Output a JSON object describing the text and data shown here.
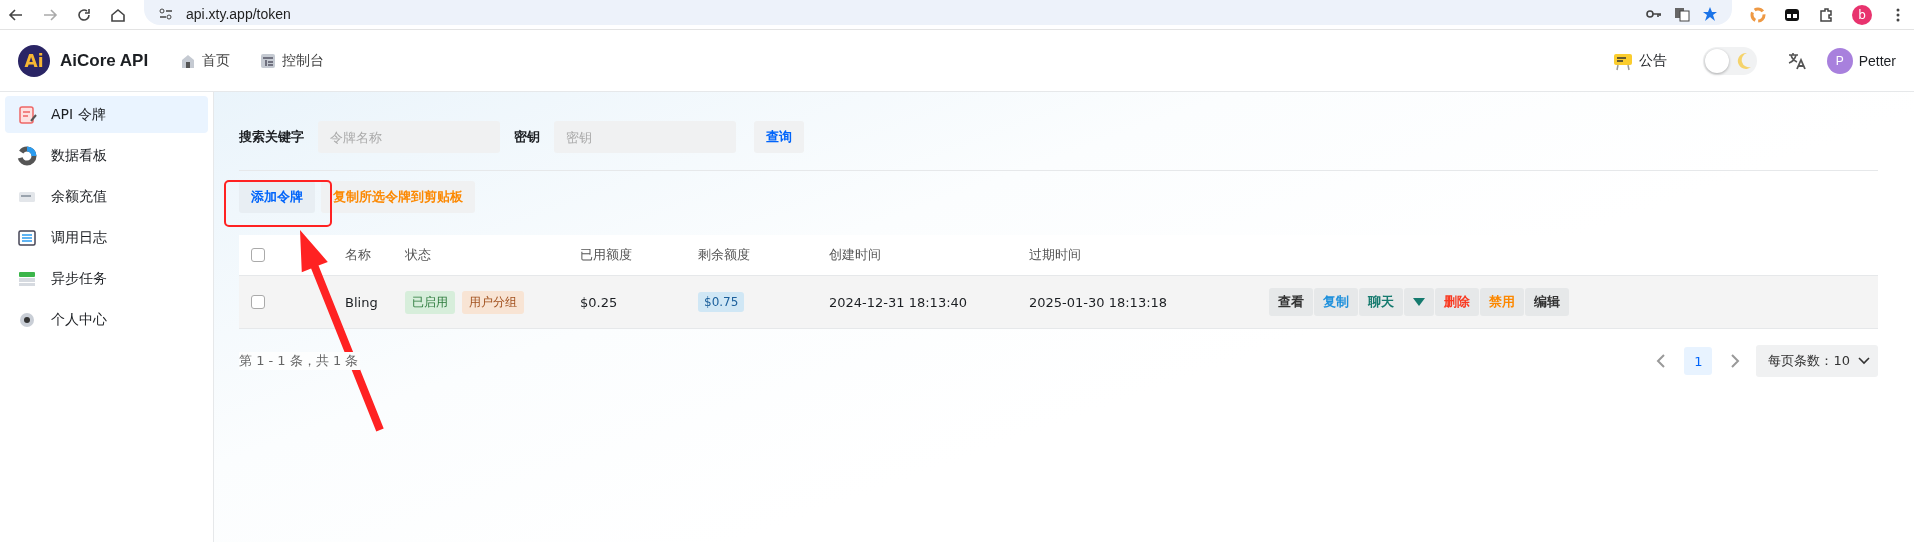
{
  "browser": {
    "url": "api.xty.app/token",
    "profile": "b"
  },
  "header": {
    "logo_text": "Ai",
    "brand": "AiCore API",
    "nav": [
      {
        "label": "首页"
      },
      {
        "label": "控制台"
      }
    ],
    "notice": "公告",
    "theme_toggle": {
      "on": false
    },
    "user": {
      "initial": "P",
      "name": "Petter"
    }
  },
  "sidebar": {
    "items": [
      {
        "label": "API 令牌",
        "selected": true
      },
      {
        "label": "数据看板",
        "selected": false
      },
      {
        "label": "余额充值",
        "selected": false
      },
      {
        "label": "调用日志",
        "selected": false
      },
      {
        "label": "异步任务",
        "selected": false
      },
      {
        "label": "个人中心",
        "selected": false
      }
    ]
  },
  "search": {
    "fields": [
      {
        "label": "搜索关键字",
        "placeholder": "令牌名称"
      },
      {
        "label": "密钥",
        "placeholder": "密钥"
      }
    ],
    "button": "查询"
  },
  "actions": [
    {
      "label": "添加令牌",
      "kind": "primary"
    },
    {
      "label": "复制所选令牌到剪贴板",
      "kind": "warning"
    }
  ],
  "table": {
    "columns": [
      "名称",
      "状态",
      "已用额度",
      "剩余额度",
      "创建时间",
      "过期时间"
    ],
    "all_checked": false,
    "rows": [
      {
        "checked": false,
        "name": "Bling",
        "tags": [
          {
            "label": "已启用",
            "kind": "success"
          },
          {
            "label": "用户分组",
            "kind": "warning"
          }
        ],
        "used": "$0.25",
        "remaining": "$0.75",
        "created": "2024-12-31 18:13:40",
        "expires": "2025-01-30 18:13:18",
        "buttons": [
          {
            "label": "查看",
            "kind": "default"
          },
          {
            "label": "复制",
            "kind": "info"
          },
          {
            "label": "聊天",
            "kind": "teal"
          },
          {
            "kind": "dropdown"
          },
          {
            "label": "删除",
            "kind": "danger"
          },
          {
            "label": "禁用",
            "kind": "warning"
          },
          {
            "label": "编辑",
            "kind": "default"
          }
        ]
      }
    ]
  },
  "footer": {
    "summary": "第 1 - 1 条，共 1 条",
    "pages": [
      {
        "label": "1",
        "selected": true
      }
    ],
    "page_size": "每页条数：10"
  }
}
